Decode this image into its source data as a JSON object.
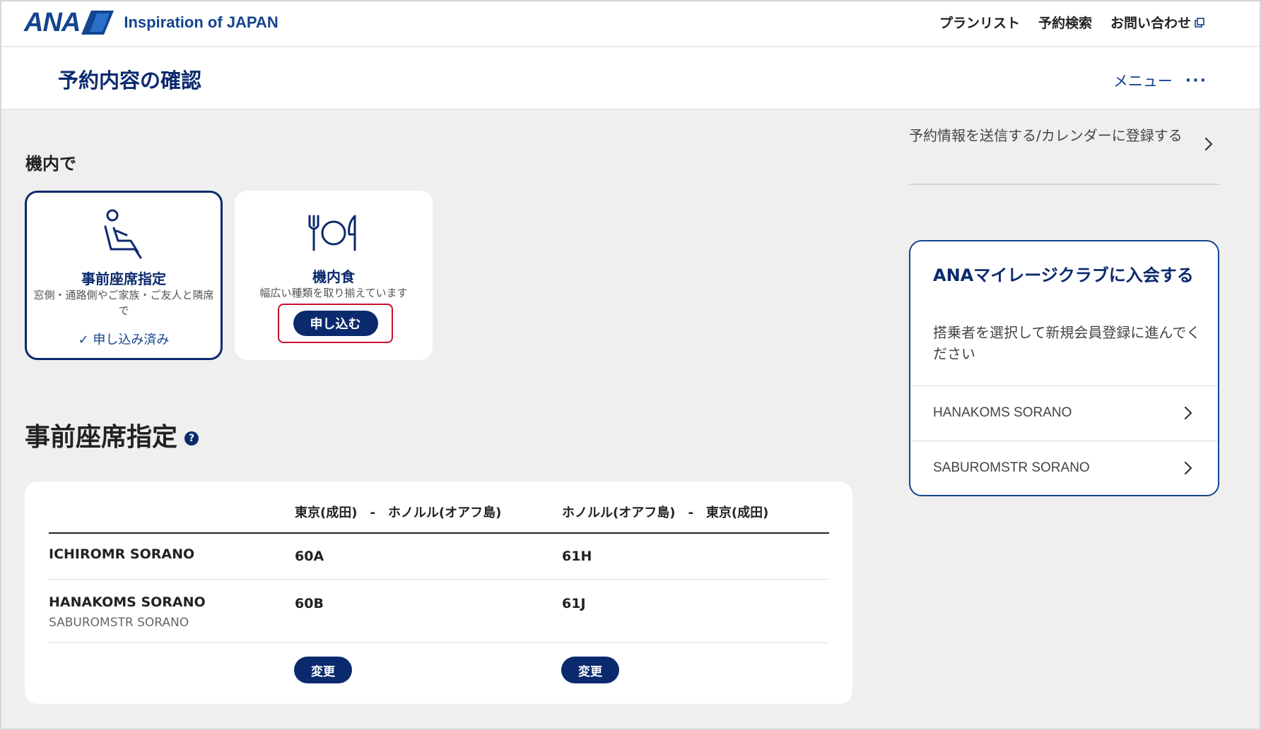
{
  "header": {
    "logo": "ANA",
    "tagline": "Inspiration of JAPAN",
    "nav": [
      "プランリスト",
      "予約検索",
      "お問い合わせ"
    ]
  },
  "titlebar": {
    "title": "予約内容の確認",
    "menu_label": "メニュー",
    "menu_dots": "···"
  },
  "inflight": {
    "heading": "機内で",
    "seat_card": {
      "title": "事前座席指定",
      "desc": "窓側・通路側やご家族・ご友人と隣席で",
      "status": "✓ 申し込み済み"
    },
    "meal_card": {
      "title": "機内食",
      "desc": "幅広い種類を取り揃えています",
      "button": "申し込む"
    }
  },
  "seat_section": {
    "heading": "事前座席指定",
    "help_icon": "?",
    "columns": [
      "東京(成田)　-　ホノルル(オアフ島)",
      "ホノルル(オアフ島)　-　東京(成田)"
    ],
    "rows": [
      {
        "name": "ICHIROMR SORANO",
        "sub": "",
        "seat1": "60A",
        "seat2": "61H"
      },
      {
        "name": "HANAKOMS SORANO",
        "sub": "SABUROMSTR SORANO",
        "seat1": "60B",
        "seat2": "61J"
      }
    ],
    "change_button": "変更"
  },
  "sidebar": {
    "send_link": "予約情報を送信する/カレンダーに登録する",
    "amc": {
      "title": "ANAマイレージクラブに入会する",
      "desc": "搭乗者を選択して新規会員登録に進んでください",
      "items": [
        "HANAKOMS SORANO",
        "SABUROMSTR SORANO"
      ]
    }
  },
  "colors": {
    "brand": "#13448f",
    "dark_navy": "#0b2a6e",
    "highlight": "#c8102e"
  }
}
